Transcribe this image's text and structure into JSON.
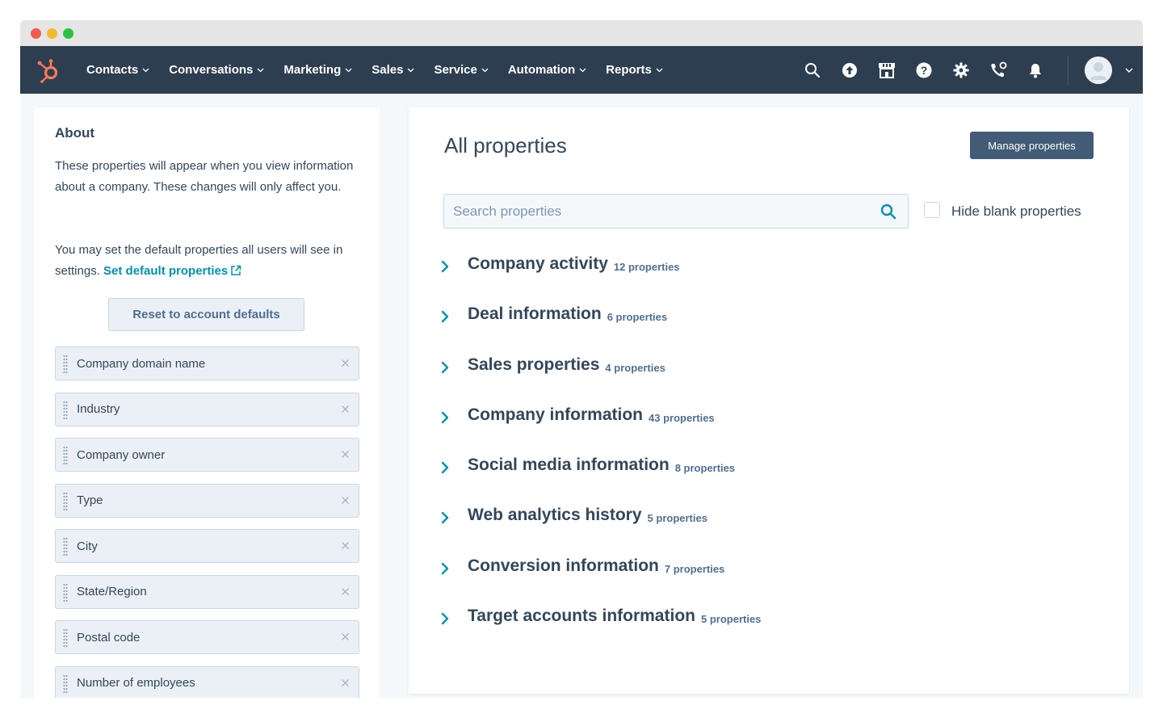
{
  "nav": {
    "menu": [
      {
        "label": "Contacts"
      },
      {
        "label": "Conversations"
      },
      {
        "label": "Marketing"
      },
      {
        "label": "Sales"
      },
      {
        "label": "Service"
      },
      {
        "label": "Automation"
      },
      {
        "label": "Reports"
      }
    ],
    "icons": [
      "search-icon",
      "upgrade-arrow-icon",
      "marketplace-icon",
      "help-icon",
      "settings-gear-icon",
      "calling-icon",
      "notifications-bell-icon"
    ],
    "colors": {
      "navbar": "#2d3e50",
      "logo": "#ff7a59"
    }
  },
  "about": {
    "title": "About",
    "paragraph1": "These properties will appear when you view information about a company. These changes will only affect you.",
    "paragraph2_prefix": "You may set the default properties all users will see in settings.",
    "set_default_link": "Set default properties",
    "reset_button": "Reset to account defaults",
    "properties": [
      {
        "label": "Company domain name"
      },
      {
        "label": "Industry"
      },
      {
        "label": "Company owner"
      },
      {
        "label": "Type"
      },
      {
        "label": "City"
      },
      {
        "label": "State/Region"
      },
      {
        "label": "Postal code"
      },
      {
        "label": "Number of employees"
      }
    ]
  },
  "main": {
    "title": "All properties",
    "manage_button": "Manage properties",
    "search_placeholder": "Search properties",
    "hide_blank_label": "Hide blank properties",
    "groups": [
      {
        "title": "Company activity",
        "count": "12 properties"
      },
      {
        "title": "Deal information",
        "count": "6 properties"
      },
      {
        "title": "Sales properties",
        "count": "4 properties"
      },
      {
        "title": "Company information",
        "count": "43 properties"
      },
      {
        "title": "Social media information",
        "count": "8 properties"
      },
      {
        "title": "Web analytics history",
        "count": "5 properties"
      },
      {
        "title": "Conversion information",
        "count": "7 properties"
      },
      {
        "title": "Target accounts information",
        "count": "5 properties"
      }
    ],
    "colors": {
      "link": "#0091ae",
      "chevron": "#0091ae",
      "manage_button": "#425b76"
    }
  }
}
